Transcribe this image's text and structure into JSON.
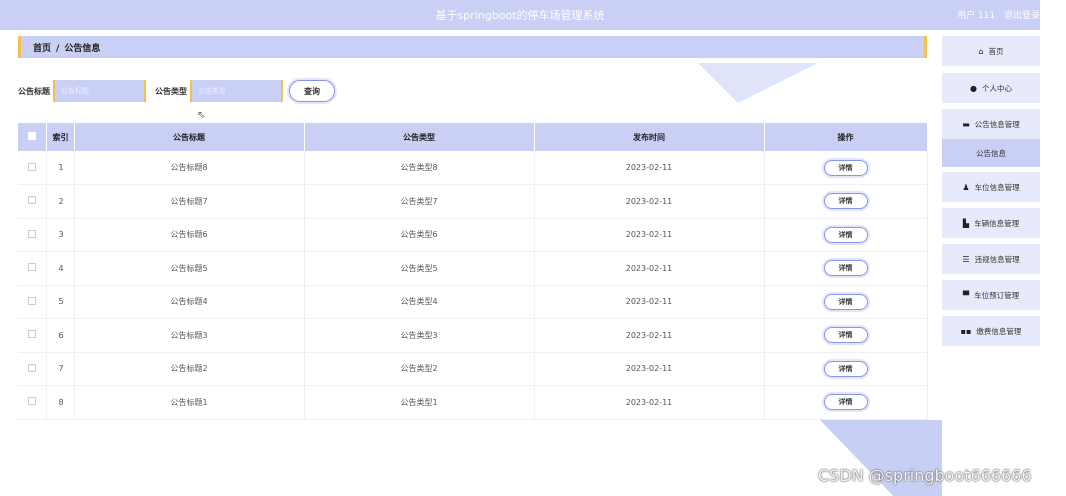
{
  "header": {
    "title": "基于springboot的停车场管理系统",
    "user_label": "用户 111",
    "logout_label": "退出登录"
  },
  "breadcrumb": {
    "home": "首页",
    "separator": "/",
    "current": "公告信息"
  },
  "search": {
    "title_label": "公告标题",
    "title_placeholder": "公告标题",
    "type_label": "公告类型",
    "type_placeholder": "公告类型",
    "query_button": "查询"
  },
  "table": {
    "headers": [
      "索引",
      "公告标题",
      "公告类型",
      "发布时间",
      "操作"
    ],
    "detail_button": "详情",
    "rows": [
      {
        "index": "1",
        "title": "公告标题8",
        "type": "公告类型8",
        "date": "2023-02-11"
      },
      {
        "index": "2",
        "title": "公告标题7",
        "type": "公告类型7",
        "date": "2023-02-11"
      },
      {
        "index": "3",
        "title": "公告标题6",
        "type": "公告类型6",
        "date": "2023-02-11"
      },
      {
        "index": "4",
        "title": "公告标题5",
        "type": "公告类型5",
        "date": "2023-02-11"
      },
      {
        "index": "5",
        "title": "公告标题4",
        "type": "公告类型4",
        "date": "2023-02-11"
      },
      {
        "index": "6",
        "title": "公告标题3",
        "type": "公告类型3",
        "date": "2023-02-11"
      },
      {
        "index": "7",
        "title": "公告标题2",
        "type": "公告类型2",
        "date": "2023-02-11"
      },
      {
        "index": "8",
        "title": "公告标题1",
        "type": "公告类型1",
        "date": "2023-02-11"
      }
    ]
  },
  "sidebar": {
    "items": [
      {
        "label": "首页",
        "icon": "home-icon"
      },
      {
        "label": "个人中心",
        "icon": "user-icon"
      },
      {
        "label": "公告信息管理",
        "icon": "monitor-icon"
      },
      {
        "label": "车位信息管理",
        "icon": "users-icon"
      },
      {
        "label": "车辆信息管理",
        "icon": "chart-icon"
      },
      {
        "label": "违规信息管理",
        "icon": "list-icon"
      },
      {
        "label": "车位预订管理",
        "icon": "calendar-icon"
      },
      {
        "label": "缴费信息管理",
        "icon": "grid-icon"
      }
    ],
    "submenu_active": "公告信息"
  },
  "watermark": "CSDN @springboot666666"
}
